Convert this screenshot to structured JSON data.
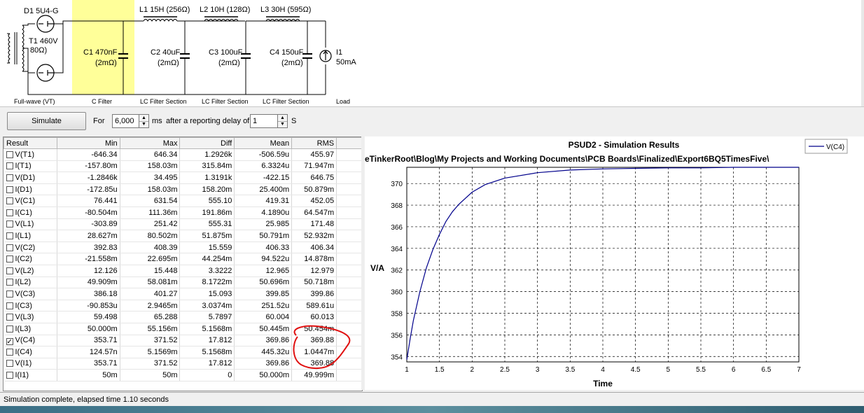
{
  "schematic": {
    "diode_label": "D1 5U4-G",
    "transformer_label": [
      "T1 460V",
      "80Ω)"
    ],
    "stages": [
      {
        "cap": "C1 470nF",
        "esr": "(2mΩ)",
        "section": "C Filter"
      },
      {
        "inductor": "L1 15H (256Ω)",
        "cap": "C2 40uF",
        "esr": "(2mΩ)",
        "section": "LC Filter Section"
      },
      {
        "inductor": "L2 10H (128Ω)",
        "cap": "C3 100uF",
        "esr": "(2mΩ)",
        "section": "LC Filter Section"
      },
      {
        "inductor": "L3 30H (595Ω)",
        "cap": "C4 150uF",
        "esr": "(2mΩ)",
        "section": "LC Filter Section"
      }
    ],
    "load": {
      "name": "I1",
      "value": "50mA",
      "section": "Load"
    },
    "rectifier_section": "Full-wave (VT)",
    "highlight_color": "#ffff99"
  },
  "toolbar": {
    "simulate_label": "Simulate",
    "for_label": "For",
    "duration_value": "6,000",
    "ms_label": "ms",
    "delay_label": "after a reporting delay of",
    "delay_value": "1",
    "s_label": "S"
  },
  "results": {
    "headers": [
      "Result",
      "Min",
      "Max",
      "Diff",
      "Mean",
      "RMS"
    ],
    "rows": [
      {
        "name": "V(T1)",
        "checked": false,
        "min": "-646.34",
        "max": "646.34",
        "diff": "1.2926k",
        "mean": "-506.59u",
        "rms": "455.97"
      },
      {
        "name": "I(T1)",
        "checked": false,
        "min": "-157.80m",
        "max": "158.03m",
        "diff": "315.84m",
        "mean": "6.3324u",
        "rms": "71.947m"
      },
      {
        "name": "V(D1)",
        "checked": false,
        "min": "-1.2846k",
        "max": "34.495",
        "diff": "1.3191k",
        "mean": "-422.15",
        "rms": "646.75"
      },
      {
        "name": "I(D1)",
        "checked": false,
        "min": "-172.85u",
        "max": "158.03m",
        "diff": "158.20m",
        "mean": "25.400m",
        "rms": "50.879m"
      },
      {
        "name": "V(C1)",
        "checked": false,
        "min": "76.441",
        "max": "631.54",
        "diff": "555.10",
        "mean": "419.31",
        "rms": "452.05"
      },
      {
        "name": "I(C1)",
        "checked": false,
        "min": "-80.504m",
        "max": "111.36m",
        "diff": "191.86m",
        "mean": "4.1890u",
        "rms": "64.547m"
      },
      {
        "name": "V(L1)",
        "checked": false,
        "min": "-303.89",
        "max": "251.42",
        "diff": "555.31",
        "mean": "25.985",
        "rms": "171.48"
      },
      {
        "name": "I(L1)",
        "checked": false,
        "min": "28.627m",
        "max": "80.502m",
        "diff": "51.875m",
        "mean": "50.791m",
        "rms": "52.932m"
      },
      {
        "name": "V(C2)",
        "checked": false,
        "min": "392.83",
        "max": "408.39",
        "diff": "15.559",
        "mean": "406.33",
        "rms": "406.34"
      },
      {
        "name": "I(C2)",
        "checked": false,
        "min": "-21.558m",
        "max": "22.695m",
        "diff": "44.254m",
        "mean": "94.522u",
        "rms": "14.878m"
      },
      {
        "name": "V(L2)",
        "checked": false,
        "min": "12.126",
        "max": "15.448",
        "diff": "3.3222",
        "mean": "12.965",
        "rms": "12.979"
      },
      {
        "name": "I(L2)",
        "checked": false,
        "min": "49.909m",
        "max": "58.081m",
        "diff": "8.1722m",
        "mean": "50.696m",
        "rms": "50.718m"
      },
      {
        "name": "V(C3)",
        "checked": false,
        "min": "386.18",
        "max": "401.27",
        "diff": "15.093",
        "mean": "399.85",
        "rms": "399.86"
      },
      {
        "name": "I(C3)",
        "checked": false,
        "min": "-90.853u",
        "max": "2.9465m",
        "diff": "3.0374m",
        "mean": "251.52u",
        "rms": "589.61u"
      },
      {
        "name": "V(L3)",
        "checked": false,
        "min": "59.498",
        "max": "65.288",
        "diff": "5.7897",
        "mean": "60.004",
        "rms": "60.013"
      },
      {
        "name": "I(L3)",
        "checked": false,
        "min": "50.000m",
        "max": "55.156m",
        "diff": "5.1568m",
        "mean": "50.445m",
        "rms": "50.454m"
      },
      {
        "name": "V(C4)",
        "checked": true,
        "min": "353.71",
        "max": "371.52",
        "diff": "17.812",
        "mean": "369.86",
        "rms": "369.88"
      },
      {
        "name": "I(C4)",
        "checked": false,
        "min": "124.57n",
        "max": "5.1569m",
        "diff": "5.1568m",
        "mean": "445.32u",
        "rms": "1.0447m"
      },
      {
        "name": "V(I1)",
        "checked": false,
        "min": "353.71",
        "max": "371.52",
        "diff": "17.812",
        "mean": "369.86",
        "rms": "369.88"
      },
      {
        "name": "I(I1)",
        "checked": false,
        "min": "50m",
        "max": "50m",
        "diff": "0",
        "mean": "50.000m",
        "rms": "49.999m"
      }
    ]
  },
  "chart_data": {
    "type": "line",
    "title": "PSUD2 - Simulation Results",
    "subtitle": "eTinkerRoot\\Blog\\My Projects and Working Documents\\PCB Boards\\Finalized\\Export6BQ5TimesFive\\",
    "xlabel": "Time",
    "ylabel": "V/A",
    "xlim": [
      1,
      7
    ],
    "ylim": [
      353.5,
      371.5
    ],
    "xticks": [
      "1",
      "1.5",
      "2",
      "2.5",
      "3",
      "3.5",
      "4",
      "4.5",
      "5",
      "5.5",
      "6",
      "6.5",
      "7"
    ],
    "yticks": [
      "354",
      "356",
      "358",
      "360",
      "362",
      "364",
      "366",
      "368",
      "370"
    ],
    "grid": true,
    "legend_position": "top-right",
    "series": [
      {
        "name": "V(C4)",
        "color": "#00008b",
        "x": [
          1.0,
          1.05,
          1.1,
          1.2,
          1.3,
          1.4,
          1.5,
          1.6,
          1.7,
          1.8,
          2.0,
          2.2,
          2.5,
          3.0,
          3.5,
          4.0,
          4.5,
          5.0,
          5.5,
          6.0,
          6.5,
          7.0
        ],
        "y": [
          353.7,
          355.6,
          357.3,
          360.0,
          362.2,
          363.9,
          365.3,
          366.5,
          367.4,
          368.1,
          369.2,
          369.9,
          370.5,
          371.0,
          371.25,
          371.35,
          371.4,
          371.45,
          371.45,
          371.5,
          371.5,
          371.5
        ]
      }
    ]
  },
  "status": {
    "message": "Simulation complete, elapsed time 1.10 seconds"
  }
}
